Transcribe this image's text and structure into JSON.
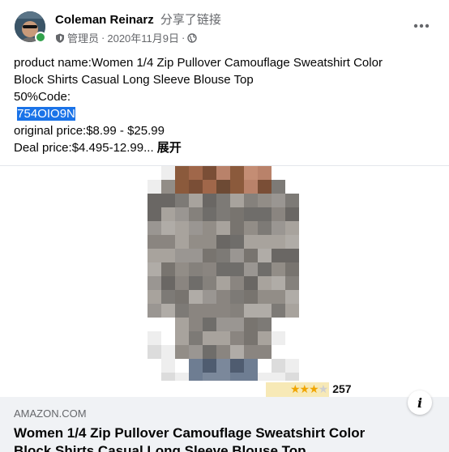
{
  "post": {
    "author": "Coleman Reinarz",
    "action": "分享了链接",
    "role": "管理员",
    "date": "2020年11月9日",
    "separator": "·",
    "icons": {
      "avatar": "avatar-photo",
      "online": "online-status-dot",
      "role": "admin-shield-icon",
      "audience": "globe-icon",
      "more": "more-options-icon"
    },
    "text": {
      "line1": "product name:Women 1/4 Zip Pullover Camouflage Sweatshirt Color",
      "line2": "Block Shirts Casual Long Sleeve Blouse Top",
      "line3": "50%Code:",
      "code": "754OIO9N",
      "line5": "original price:$8.99 - $25.99",
      "line6": "Deal price:$4.495-12.99...",
      "see_more": "展开"
    }
  },
  "media": {
    "image_icon": "blurred-product-image",
    "rating": {
      "stars_filled": 3,
      "stars_total": 4,
      "count": "257"
    }
  },
  "link_preview": {
    "domain": "AMAZON.COM",
    "title": "Women 1/4 Zip Pullover Camouflage Sweatshirt Color Block Shirts Casual Long Sleeve Blouse Top",
    "info_icon": "info-icon"
  },
  "colors": {
    "highlight": "#1a73e8",
    "online": "#31a24c",
    "secondary_text": "#65676b",
    "preview_bg": "#f0f2f5"
  }
}
